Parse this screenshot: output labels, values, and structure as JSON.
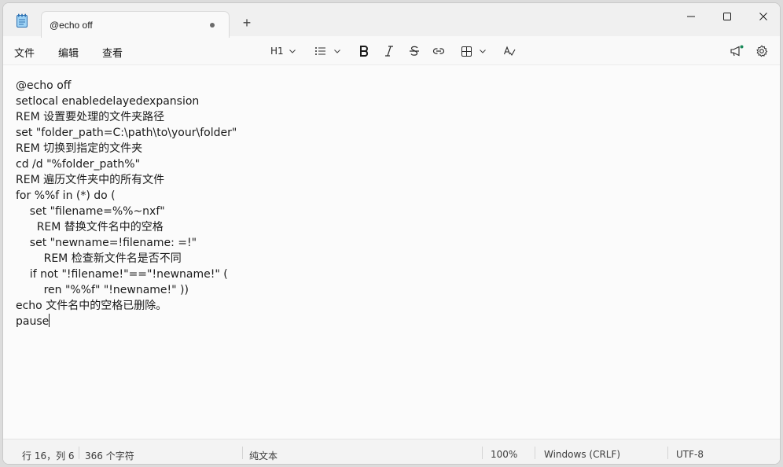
{
  "tab": {
    "title": "@echo off",
    "new_tab": "+"
  },
  "menu": {
    "file": "文件",
    "edit": "编辑",
    "view": "查看"
  },
  "toolbar": {
    "heading": "H1"
  },
  "editor": {
    "lines": [
      "@echo off",
      "setlocal enabledelayedexpansion",
      "REM 设置要处理的文件夹路径",
      "set \"folder_path=C:\\path\\to\\your\\folder\"",
      "REM 切换到指定的文件夹",
      "cd /d \"%folder_path%\"",
      "REM 遍历文件夹中的所有文件",
      "for %%f in (*) do (",
      "    set \"filename=%%~nxf\"",
      "      REM 替换文件名中的空格",
      "    set \"newname=!filename: =!\"",
      "        REM 检查新文件名是否不同",
      "    if not \"!filename!\"==\"!newname!\" (",
      "        ren \"%%f\" \"!newname!\" ))",
      "echo 文件名中的空格已删除。",
      "pause"
    ]
  },
  "status": {
    "position": "行 16，列 6",
    "char_count": "366 个字符",
    "format": "纯文本",
    "zoom": "100%",
    "line_ending": "Windows (CRLF)",
    "encoding": "UTF-8"
  },
  "colors": {
    "notification_dot": "#1b8a5a"
  }
}
